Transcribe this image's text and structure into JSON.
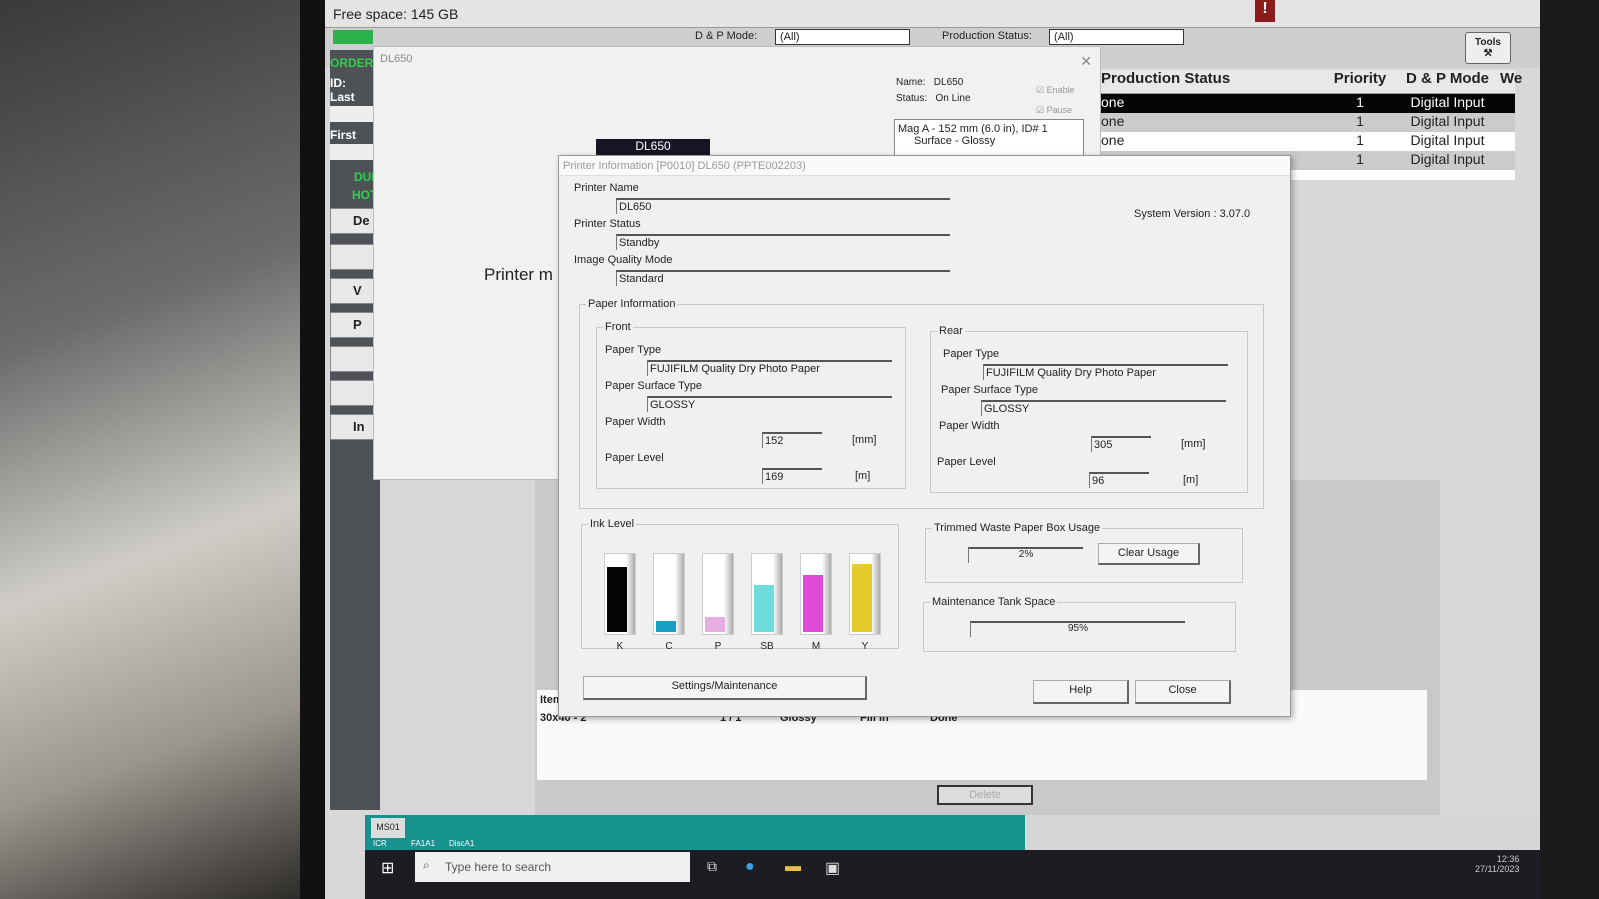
{
  "app": {
    "free_space": "Free space: 145 GB",
    "dp_mode_label": "D & P Mode:",
    "dp_mode_value": "(All)",
    "prod_status_label": "Production Status:",
    "prod_status_value": "(All)",
    "tools_label": "Tools",
    "alert_icon": "!"
  },
  "sidebar": {
    "order": "ORDER",
    "id": "ID:",
    "last": "Last",
    "first": "First",
    "due": "DUE",
    "hot": "HOT",
    "buttons": [
      "De",
      "",
      "V",
      "P",
      "",
      "",
      "In"
    ]
  },
  "grid": {
    "headers": [
      "Production Status",
      "Priority",
      "D & P Mode",
      "We"
    ],
    "rows": [
      [
        "one",
        "1",
        "Digital Input"
      ],
      [
        "one",
        "1",
        "Digital Input"
      ],
      [
        "one",
        "1",
        "Digital Input"
      ],
      [
        "one",
        "1",
        "Digital Input"
      ]
    ]
  },
  "printer_window": {
    "title": "DL650",
    "dark_label": "DL650",
    "printer_text": "Printer m",
    "name_label": "Name:",
    "name_value": "DL650",
    "status_label": "Status:",
    "status_value": "On Line",
    "enable": "Enable",
    "pause": "Pause",
    "mag": "Mag A  -  152 mm (6.0 in), ID# 1",
    "surface": "Surface - Glossy"
  },
  "items": {
    "header": "Item",
    "row": [
      "30x40 - 2",
      "1 / 1",
      "Glossy",
      "Fill in",
      "Done"
    ],
    "delete": "Delete"
  },
  "dialog": {
    "title": "Printer Information  [P0010] DL650  (PPTE002203)",
    "printer_name_label": "Printer Name",
    "printer_name": "DL650",
    "printer_status_label": "Printer Status",
    "printer_status": "Standby",
    "iq_label": "Image Quality Mode",
    "iq": "Standard",
    "system_version": "System Version :  3.07.0",
    "paper_info": "Paper Information",
    "front": {
      "title": "Front",
      "type_label": "Paper Type",
      "type": "FUJIFILM Quality Dry Photo Paper",
      "surface_label": "Paper Surface Type",
      "surface": "GLOSSY",
      "width_label": "Paper Width",
      "width": "152",
      "width_unit": "[mm]",
      "level_label": "Paper Level",
      "level": "169",
      "level_unit": "[m]"
    },
    "rear": {
      "title": "Rear",
      "type_label": "Paper Type",
      "type": "FUJIFILM Quality Dry Photo Paper",
      "surface_label": "Paper Surface Type",
      "surface": "GLOSSY",
      "width_label": "Paper Width",
      "width": "305",
      "width_unit": "[mm]",
      "level_label": "Paper Level",
      "level": "96",
      "level_unit": "[m]"
    },
    "ink_title": "Ink Level",
    "inks": [
      {
        "label": "K",
        "color": "#050505",
        "level": 85
      },
      {
        "label": "C",
        "color": "#1a9fc4",
        "level": 14
      },
      {
        "label": "P",
        "color": "#e6aee0",
        "level": 20
      },
      {
        "label": "SB",
        "color": "#6fdcdc",
        "level": 62
      },
      {
        "label": "M",
        "color": "#e04ad8",
        "level": 75
      },
      {
        "label": "Y",
        "color": "#e5cb2e",
        "level": 90
      }
    ],
    "waste_title": "Trimmed Waste Paper Box Usage",
    "waste": "2%",
    "clear_usage": "Clear Usage",
    "tank_title": "Maintenance Tank Space",
    "tank": "95%",
    "settings": "Settings/Maintenance",
    "help": "Help",
    "close": "Close"
  },
  "taskbar": {
    "ms01": "MS01",
    "ico1": "ICR",
    "fa": "FA1A1",
    "disc": "DiscA1",
    "search_placeholder": "Type here to search",
    "time": "12:36",
    "date": "27/11/2023"
  }
}
